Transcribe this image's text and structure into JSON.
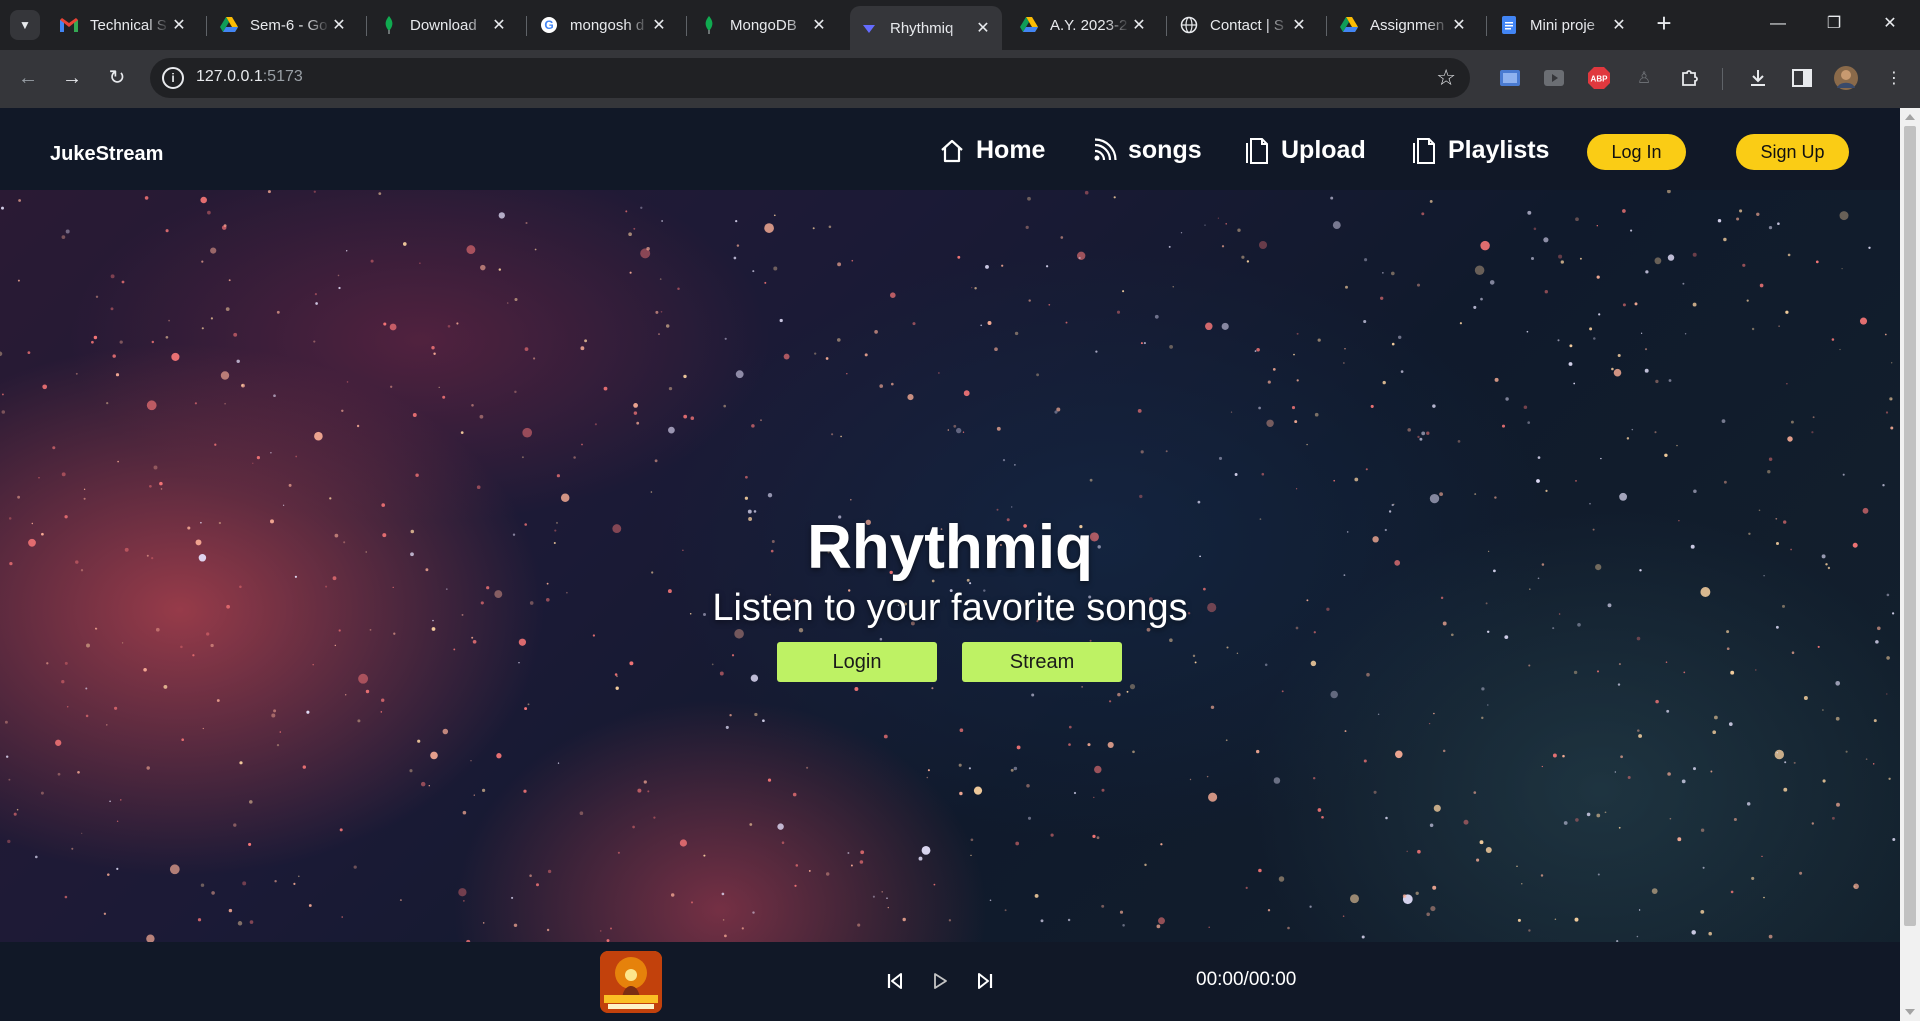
{
  "browser": {
    "tabs": [
      {
        "title": "Technical S",
        "icon": "gmail-icon"
      },
      {
        "title": "Sem-6 - Go",
        "icon": "google-drive-icon"
      },
      {
        "title": "Download",
        "icon": "mongodb-leaf-icon"
      },
      {
        "title": "mongosh d",
        "icon": "google-icon"
      },
      {
        "title": "MongoDB",
        "icon": "mongodb-leaf-icon"
      },
      {
        "title": "Rhythmiq",
        "icon": "vite-icon",
        "active": true
      },
      {
        "title": "A.Y. 2023-2",
        "icon": "google-drive-icon"
      },
      {
        "title": "Contact | S",
        "icon": "globe-icon"
      },
      {
        "title": "Assignmen",
        "icon": "google-drive-icon"
      },
      {
        "title": "Mini proje",
        "icon": "google-docs-icon"
      }
    ],
    "url_host": "127.0.0.1",
    "url_port": ":5173",
    "extensions": [
      "screen-cast-icon",
      "video-ext-icon",
      "adblock-icon",
      "ghost-ext-icon",
      "puzzle-extensions-icon",
      "download-icon",
      "sidepanel-icon",
      "profile-avatar"
    ],
    "adblock_label": "ABP"
  },
  "navbar": {
    "brand": "JukeStream",
    "links": [
      "Home",
      "songs",
      "Upload",
      "Playlists"
    ],
    "login": "Log In",
    "signup": "Sign Up"
  },
  "hero": {
    "title": "Rhythmiq",
    "subtitle": "Listen to your favorite songs",
    "buttons": [
      "Login",
      "Stream"
    ]
  },
  "player": {
    "time": "00:00/00:00"
  },
  "colors": {
    "navbar_bg": "#111827",
    "pill_yellow": "#facc15",
    "hero_button": "#bef264"
  }
}
